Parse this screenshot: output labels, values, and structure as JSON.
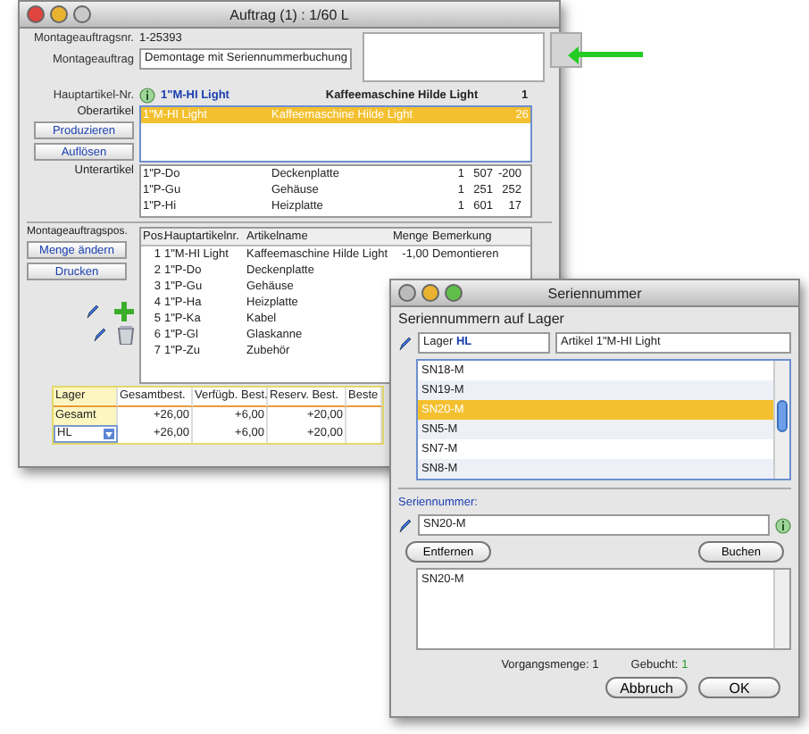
{
  "main_window": {
    "title": "Auftrag (1) : 1/60 L",
    "order_number_label": "Montageauftragsnr.",
    "order_number": "1-25393",
    "order_label": "Montageauftrag",
    "order_value": "Demontage mit Seriennummerbuchung",
    "main_article_label": "Hauptartikel-Nr.",
    "main_article_number": "1\"M-HI Light",
    "main_article_name": "Kaffeemaschine Hilde Light",
    "main_article_qty": "1",
    "parent_label": "Oberartikel",
    "parent_rows": [
      {
        "number": "1\"M-HI Light",
        "name": "Kaffeemaschine Hilde Light",
        "qty": "26",
        "selected": true
      }
    ],
    "parent_buttons": [
      "Produzieren",
      "Auflösen"
    ],
    "child_label": "Unterartikel",
    "child_rows": [
      {
        "number": "1\"P-Do",
        "name": "Deckenplatte",
        "values": [
          "1",
          "507",
          "-200"
        ]
      },
      {
        "number": "1\"P-Gu",
        "name": "Gehäuse",
        "values": [
          "1",
          "251",
          "252"
        ]
      },
      {
        "number": "1\"P-Hi",
        "name": "Heizplatte",
        "values": [
          "1",
          "601",
          "17"
        ]
      }
    ],
    "positions_label": "Montageauftragspos.",
    "position_buttons": [
      "Menge ändern",
      "Drucken"
    ],
    "positions_table": {
      "columns": [
        "Pos.",
        "Hauptartikelnr.",
        "Artikelname",
        "Menge",
        "Bemerkung"
      ],
      "rows": [
        [
          "1",
          "1\"M-HI Light",
          "Kaffeemaschine Hilde Light",
          "-1,00",
          "Demontieren"
        ],
        [
          "2",
          "1\"P-Do",
          "Deckenplatte",
          "",
          ""
        ],
        [
          "3",
          "1\"P-Gu",
          "Gehäuse",
          "",
          ""
        ],
        [
          "4",
          "1\"P-Ha",
          "Heizplatte",
          "",
          ""
        ],
        [
          "5",
          "1\"P-Ka",
          "Kabel",
          "",
          ""
        ],
        [
          "6",
          "1\"P-Gl",
          "Glaskanne",
          "",
          ""
        ],
        [
          "7",
          "1\"P-Zu",
          "Zubehör",
          "",
          ""
        ]
      ]
    },
    "stock": {
      "lager_label": "Lager",
      "columns": [
        "Gesamtbest.",
        "Verfügb. Best.",
        "Reserv. Best.",
        "Beste"
      ],
      "rows": [
        {
          "label": "Gesamt",
          "kind": "plain",
          "values": [
            "+26,00",
            "+6,00",
            "+20,00"
          ]
        },
        {
          "label": "HL",
          "kind": "select",
          "values": [
            "+26,00",
            "+6,00",
            "+20,00"
          ]
        }
      ]
    }
  },
  "serial_dialog": {
    "title": "Seriennummer",
    "section_label": "Seriennummern auf Lager",
    "lager_label": "Lager",
    "lager_value": "HL",
    "article_label": "Artikel",
    "article_value": "1\"M-HI Light",
    "serials": [
      {
        "text": "SN18-M",
        "selected": false
      },
      {
        "text": "SN19-M",
        "selected": false
      },
      {
        "text": "SN20-M",
        "selected": true
      },
      {
        "text": "SN5-M",
        "selected": false
      },
      {
        "text": "SN7-M",
        "selected": false
      },
      {
        "text": "SN8-M",
        "selected": false
      }
    ],
    "serial_label": "Seriennummer:",
    "serial_value": "SN20-M",
    "action_buttons": [
      "Entfernen",
      "Buchen"
    ],
    "booked": [
      "SN20-M"
    ],
    "quantity_label": "Vorgangsmenge:",
    "quantity_value": "1",
    "booked_label": "Gebucht:",
    "booked_value": "1",
    "buttons": [
      "Abbruch",
      "OK"
    ]
  }
}
